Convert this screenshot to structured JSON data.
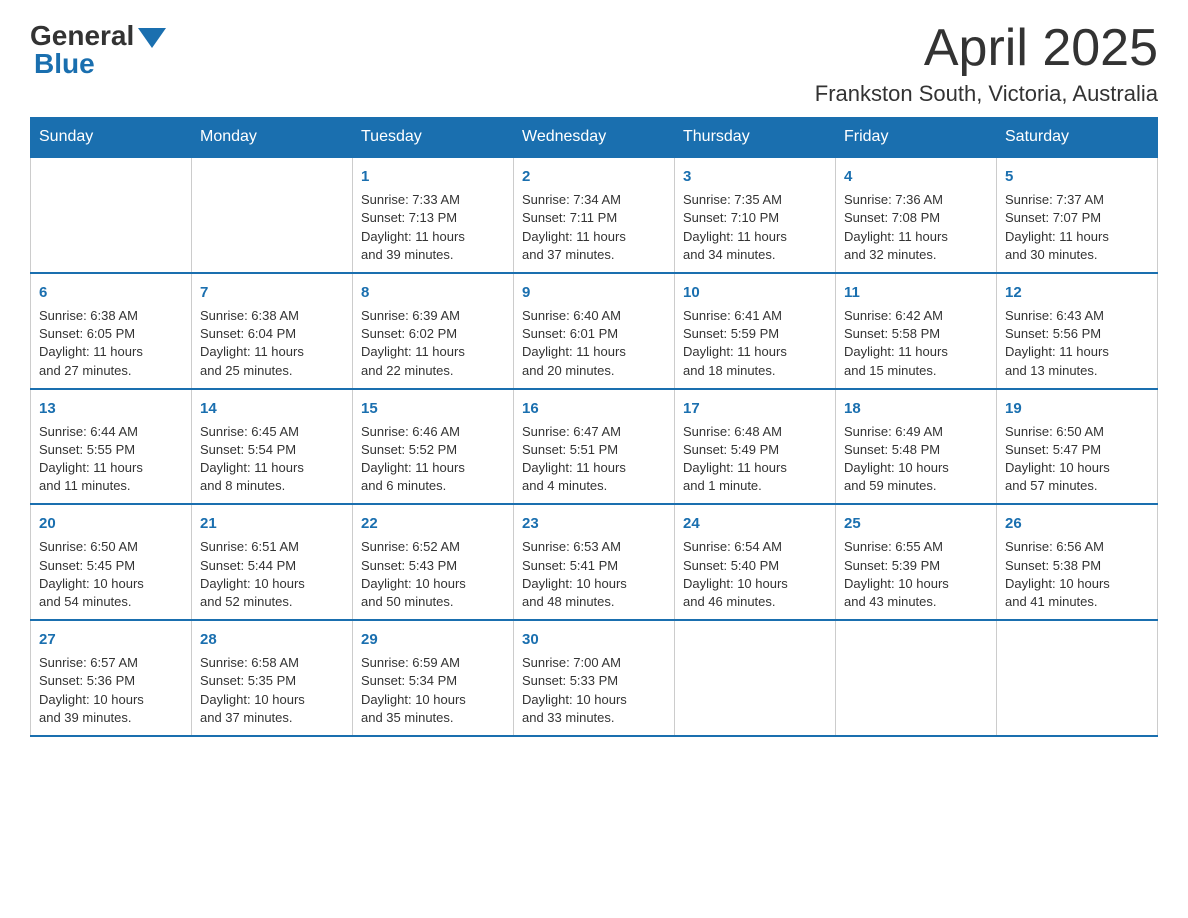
{
  "header": {
    "logo_general": "General",
    "logo_blue": "Blue",
    "month_title": "April 2025",
    "location": "Frankston South, Victoria, Australia"
  },
  "days_of_week": [
    "Sunday",
    "Monday",
    "Tuesday",
    "Wednesday",
    "Thursday",
    "Friday",
    "Saturday"
  ],
  "weeks": [
    [
      {
        "day": "",
        "info": ""
      },
      {
        "day": "",
        "info": ""
      },
      {
        "day": "1",
        "info": "Sunrise: 7:33 AM\nSunset: 7:13 PM\nDaylight: 11 hours\nand 39 minutes."
      },
      {
        "day": "2",
        "info": "Sunrise: 7:34 AM\nSunset: 7:11 PM\nDaylight: 11 hours\nand 37 minutes."
      },
      {
        "day": "3",
        "info": "Sunrise: 7:35 AM\nSunset: 7:10 PM\nDaylight: 11 hours\nand 34 minutes."
      },
      {
        "day": "4",
        "info": "Sunrise: 7:36 AM\nSunset: 7:08 PM\nDaylight: 11 hours\nand 32 minutes."
      },
      {
        "day": "5",
        "info": "Sunrise: 7:37 AM\nSunset: 7:07 PM\nDaylight: 11 hours\nand 30 minutes."
      }
    ],
    [
      {
        "day": "6",
        "info": "Sunrise: 6:38 AM\nSunset: 6:05 PM\nDaylight: 11 hours\nand 27 minutes."
      },
      {
        "day": "7",
        "info": "Sunrise: 6:38 AM\nSunset: 6:04 PM\nDaylight: 11 hours\nand 25 minutes."
      },
      {
        "day": "8",
        "info": "Sunrise: 6:39 AM\nSunset: 6:02 PM\nDaylight: 11 hours\nand 22 minutes."
      },
      {
        "day": "9",
        "info": "Sunrise: 6:40 AM\nSunset: 6:01 PM\nDaylight: 11 hours\nand 20 minutes."
      },
      {
        "day": "10",
        "info": "Sunrise: 6:41 AM\nSunset: 5:59 PM\nDaylight: 11 hours\nand 18 minutes."
      },
      {
        "day": "11",
        "info": "Sunrise: 6:42 AM\nSunset: 5:58 PM\nDaylight: 11 hours\nand 15 minutes."
      },
      {
        "day": "12",
        "info": "Sunrise: 6:43 AM\nSunset: 5:56 PM\nDaylight: 11 hours\nand 13 minutes."
      }
    ],
    [
      {
        "day": "13",
        "info": "Sunrise: 6:44 AM\nSunset: 5:55 PM\nDaylight: 11 hours\nand 11 minutes."
      },
      {
        "day": "14",
        "info": "Sunrise: 6:45 AM\nSunset: 5:54 PM\nDaylight: 11 hours\nand 8 minutes."
      },
      {
        "day": "15",
        "info": "Sunrise: 6:46 AM\nSunset: 5:52 PM\nDaylight: 11 hours\nand 6 minutes."
      },
      {
        "day": "16",
        "info": "Sunrise: 6:47 AM\nSunset: 5:51 PM\nDaylight: 11 hours\nand 4 minutes."
      },
      {
        "day": "17",
        "info": "Sunrise: 6:48 AM\nSunset: 5:49 PM\nDaylight: 11 hours\nand 1 minute."
      },
      {
        "day": "18",
        "info": "Sunrise: 6:49 AM\nSunset: 5:48 PM\nDaylight: 10 hours\nand 59 minutes."
      },
      {
        "day": "19",
        "info": "Sunrise: 6:50 AM\nSunset: 5:47 PM\nDaylight: 10 hours\nand 57 minutes."
      }
    ],
    [
      {
        "day": "20",
        "info": "Sunrise: 6:50 AM\nSunset: 5:45 PM\nDaylight: 10 hours\nand 54 minutes."
      },
      {
        "day": "21",
        "info": "Sunrise: 6:51 AM\nSunset: 5:44 PM\nDaylight: 10 hours\nand 52 minutes."
      },
      {
        "day": "22",
        "info": "Sunrise: 6:52 AM\nSunset: 5:43 PM\nDaylight: 10 hours\nand 50 minutes."
      },
      {
        "day": "23",
        "info": "Sunrise: 6:53 AM\nSunset: 5:41 PM\nDaylight: 10 hours\nand 48 minutes."
      },
      {
        "day": "24",
        "info": "Sunrise: 6:54 AM\nSunset: 5:40 PM\nDaylight: 10 hours\nand 46 minutes."
      },
      {
        "day": "25",
        "info": "Sunrise: 6:55 AM\nSunset: 5:39 PM\nDaylight: 10 hours\nand 43 minutes."
      },
      {
        "day": "26",
        "info": "Sunrise: 6:56 AM\nSunset: 5:38 PM\nDaylight: 10 hours\nand 41 minutes."
      }
    ],
    [
      {
        "day": "27",
        "info": "Sunrise: 6:57 AM\nSunset: 5:36 PM\nDaylight: 10 hours\nand 39 minutes."
      },
      {
        "day": "28",
        "info": "Sunrise: 6:58 AM\nSunset: 5:35 PM\nDaylight: 10 hours\nand 37 minutes."
      },
      {
        "day": "29",
        "info": "Sunrise: 6:59 AM\nSunset: 5:34 PM\nDaylight: 10 hours\nand 35 minutes."
      },
      {
        "day": "30",
        "info": "Sunrise: 7:00 AM\nSunset: 5:33 PM\nDaylight: 10 hours\nand 33 minutes."
      },
      {
        "day": "",
        "info": ""
      },
      {
        "day": "",
        "info": ""
      },
      {
        "day": "",
        "info": ""
      }
    ]
  ]
}
